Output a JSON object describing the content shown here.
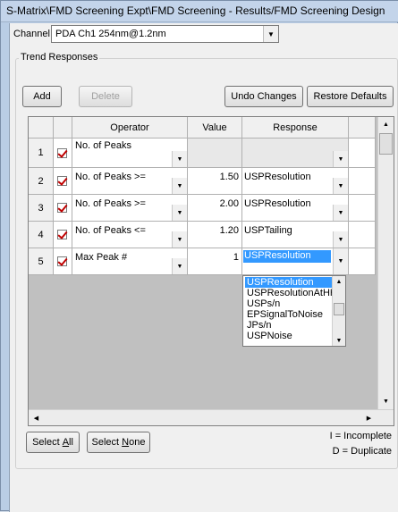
{
  "window": {
    "title": "S-Matrix\\FMD Screening Expt\\FMD Screening - Results/FMD Screening Design"
  },
  "channel": {
    "label": "Channel:",
    "value": "PDA Ch1 254nm@1.2nm"
  },
  "trend_responses": {
    "title": "Trend Responses",
    "add_label": "Add",
    "delete_label": "Delete",
    "undo_label": "Undo Changes",
    "restore_label": "Restore Defaults"
  },
  "grid": {
    "columns": [
      "Operator",
      "Value",
      "Response"
    ],
    "rows": [
      {
        "num": "1",
        "operator": "No. of Peaks",
        "value": "",
        "response": ""
      },
      {
        "num": "2",
        "operator": "No. of Peaks >=",
        "value": "1.50",
        "response": "USPResolution"
      },
      {
        "num": "3",
        "operator": "No. of Peaks >=",
        "value": "2.00",
        "response": "USPResolution"
      },
      {
        "num": "4",
        "operator": "No. of Peaks <=",
        "value": "1.20",
        "response": "USPTailing"
      },
      {
        "num": "5",
        "operator": "Max Peak #",
        "value": "1",
        "response": "USPResolution"
      }
    ],
    "response_options": [
      "USPResolution",
      "USPResolutionAtHH",
      "USPs/n",
      "EPSignalToNoise",
      "JPs/n",
      "USPNoise"
    ]
  },
  "footer": {
    "select_all": {
      "prefix": "Select ",
      "hotkey": "A",
      "suffix": "ll"
    },
    "select_none": {
      "prefix": "Select ",
      "hotkey": "N",
      "suffix": "one"
    },
    "legend_incomplete": "I = Incomplete",
    "legend_duplicate": "D = Duplicate"
  },
  "colors": {
    "selection": "#3399ff",
    "check": "#c00000",
    "titlebar": "#c3d4ea"
  }
}
